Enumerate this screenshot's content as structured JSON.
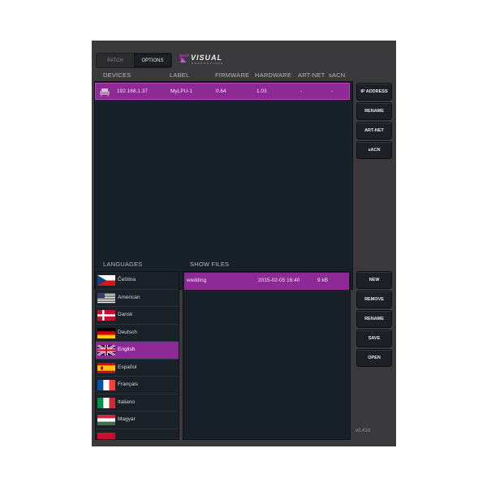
{
  "tabs": [
    "PATCH",
    "OPTIONS"
  ],
  "logo": {
    "word": "VISUAL",
    "sub": "PRODUCTIONS"
  },
  "devices": {
    "headers": [
      "DEVICES",
      "LABEL",
      "FIRMWARE",
      "HARDWARE",
      "ART-NET",
      "sACN"
    ],
    "rows": [
      {
        "address": "192.168.1.37",
        "label": "MyLPU-1",
        "firmware": "0.64",
        "hardware": "1.03",
        "artnet": "-",
        "sacn": "-"
      }
    ],
    "buttons": [
      "IP ADDRESS",
      "RENAME",
      "ART-NET",
      "sACN"
    ]
  },
  "languages": {
    "header": "LANGUAGES",
    "items": [
      "Čeština",
      "American",
      "Dansk",
      "Deutsch",
      "English",
      "Español",
      "Français",
      "Italiano",
      "Magyar"
    ],
    "selected": "English"
  },
  "show_files": {
    "header": "SHOW FILES",
    "rows": [
      {
        "name": "wedding",
        "date": "2015-02-05 16:40",
        "size": "9 kB"
      }
    ],
    "buttons": [
      "NEW",
      "REMOVE",
      "RENAME",
      "SAVE",
      "OPEN"
    ]
  },
  "version": "v0.41d",
  "colors": {
    "accent": "#8d2a96",
    "panel": "#18202a",
    "background": "#3a3a3c"
  }
}
